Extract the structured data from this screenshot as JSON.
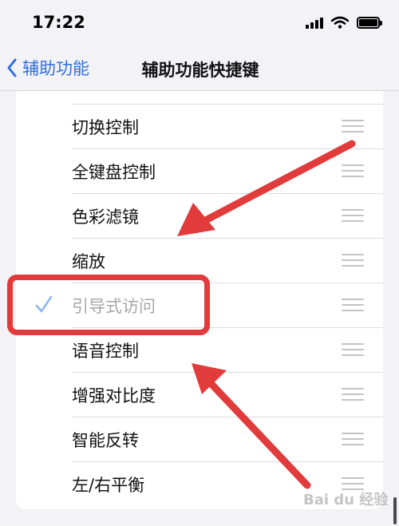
{
  "status_bar": {
    "time": "17:22"
  },
  "nav": {
    "back_label": "辅助功能",
    "title": "辅助功能快捷键"
  },
  "list": {
    "items": [
      {
        "label": "切换控制",
        "checked": false
      },
      {
        "label": "全键盘控制",
        "checked": false
      },
      {
        "label": "色彩滤镜",
        "checked": false
      },
      {
        "label": "缩放",
        "checked": false
      },
      {
        "label": "引导式访问",
        "checked": true
      },
      {
        "label": "语音控制",
        "checked": false
      },
      {
        "label": "增强对比度",
        "checked": false
      },
      {
        "label": "智能反转",
        "checked": false
      },
      {
        "label": "左/右平衡",
        "checked": false
      }
    ]
  },
  "watermark": "Bai du 经验",
  "colors": {
    "accent": "#2f6fe0",
    "annotation": "#e23b3b",
    "background": "#f2f2f7"
  }
}
